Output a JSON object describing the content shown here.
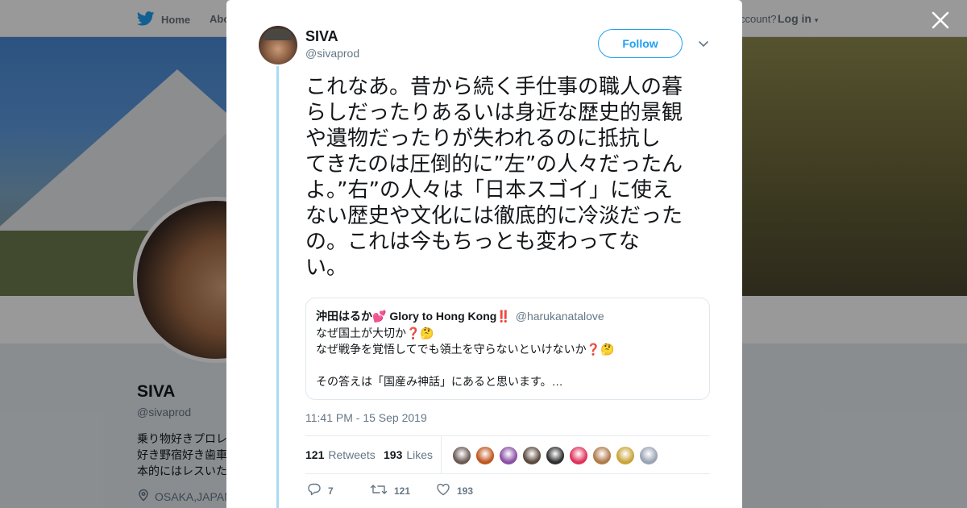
{
  "topbar": {
    "home_label": "Home",
    "about_label": "Abo",
    "account_prompt": "ccount?",
    "login_label": "Log in"
  },
  "profile": {
    "name": "SIVA",
    "handle": "@sivaprod",
    "bio_lines": [
      "乗り物好きプロレ",
      "好き野宿好き歯車",
      "本的にはレスいた"
    ],
    "location": "OSAKA,JAPAN"
  },
  "tweet": {
    "author_name": "SIVA",
    "author_handle": "@sivaprod",
    "follow_label": "Follow",
    "text_lines": [
      "これなあ。昔から続く手仕事の職人の暮",
      "らしだったりあるいは身近な歴史的景観",
      "や遺物だったりが失われるのに抵抗し",
      "てきたのは圧倒的に”左”の人々だったん",
      "よ。”右”の人々は「日本スゴイ」に使え",
      "ない歴史や文化には徹底的に冷淡だった",
      "の。これは今もちっとも変わってな",
      "い。"
    ],
    "timestamp": "11:41 PM - 15 Sep 2019",
    "retweets_count": "121",
    "retweets_label": "Retweets",
    "likes_count": "193",
    "likes_label": "Likes",
    "reply_count": "7",
    "retweet_action_count": "121",
    "like_action_count": "193"
  },
  "quoted_tweet": {
    "author_name": "沖田はるか💕 Glory to Hong Kong‼️",
    "author_handle": "@harukanatalove",
    "lines": [
      "なぜ国土が大切か❓🤔",
      "なぜ戦争を覚悟してでも領土を守らないといけないか❓🤔",
      "",
      "その答えは「国産み神話」にあると思います。…"
    ]
  },
  "likers": [
    "#6b5a55",
    "#c0561e",
    "#8a4fa6",
    "#5c4a3e",
    "#2f2f2f",
    "#e0315a",
    "#b07a4a",
    "#c9a43a",
    "#9aa3b5"
  ],
  "icons": {
    "bird": "twitter-bird-icon",
    "close": "close-icon",
    "caret": "chevron-down-icon",
    "location": "location-pin-icon",
    "reply": "reply-icon",
    "retweet": "retweet-icon",
    "like": "heart-icon"
  },
  "colors": {
    "accent": "#1da1f2",
    "thread_line": "#a7dcf5"
  }
}
